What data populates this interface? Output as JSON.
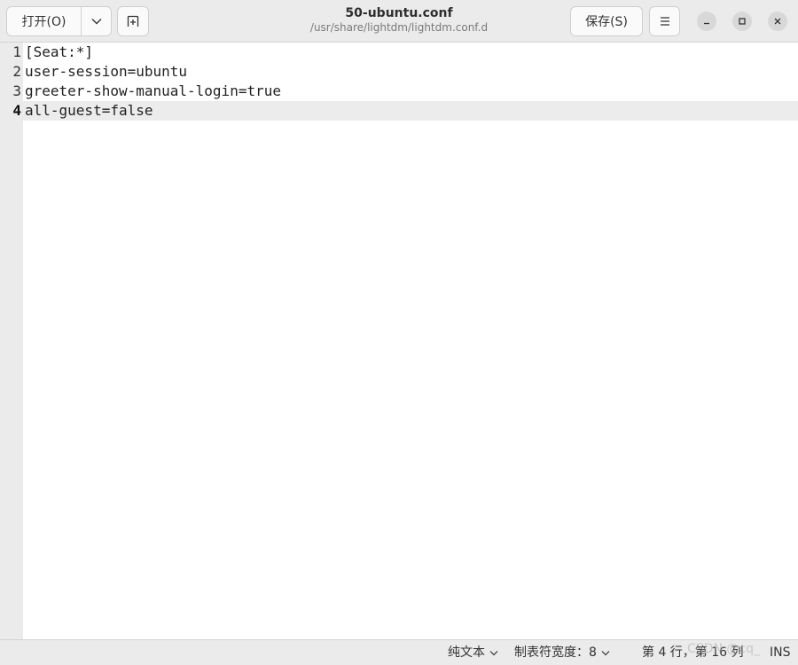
{
  "header": {
    "open_label": "打开(O)",
    "save_label": "保存(S)",
    "title": "50-ubuntu.conf",
    "subtitle": "/usr/share/lightdm/lightdm.conf.d",
    "icons": [
      "chevron-down-icon",
      "new-tab-icon",
      "hamburger-menu-icon",
      "minimize-icon",
      "maximize-icon",
      "close-icon"
    ]
  },
  "editor": {
    "current_line": 4,
    "lines": [
      {
        "number": "1",
        "text": "[Seat:*]"
      },
      {
        "number": "2",
        "text": "user-session=ubuntu"
      },
      {
        "number": "3",
        "text": "greeter-show-manual-login=true"
      },
      {
        "number": "4",
        "text": "all-guest=false"
      }
    ]
  },
  "statusbar": {
    "language": "纯文本",
    "tab_width": "制表符宽度：8",
    "position": "第 4 行，第 16 列",
    "mode": "INS"
  },
  "watermark": "CSDN @cq_",
  "colors": {
    "header_bg": "#ebebeb",
    "gutter_bg": "#ebebeb",
    "current_line_bg": "#ececec",
    "editor_bg": "#ffffff"
  }
}
